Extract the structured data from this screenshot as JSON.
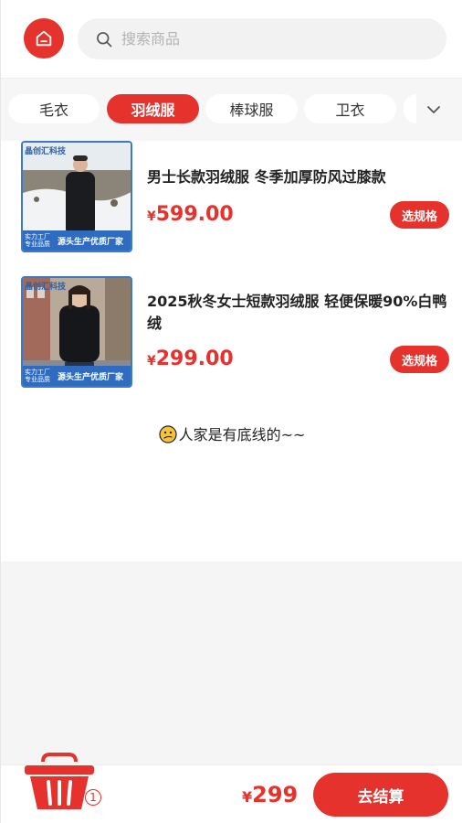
{
  "header": {
    "search": {
      "placeholder": "搜索商品",
      "value": ""
    }
  },
  "categories": {
    "tabs": [
      {
        "label": "毛衣",
        "active": false
      },
      {
        "label": "羽绒服",
        "active": true
      },
      {
        "label": "棒球服",
        "active": false
      },
      {
        "label": "卫衣",
        "active": false
      }
    ]
  },
  "products": [
    {
      "title": "男士长款羽绒服 冬季加厚防风过膝款",
      "currency": "¥",
      "price": "599.00",
      "spec_button": "选规格",
      "thumb": {
        "brand": "晶创汇科技",
        "factory": "实力工厂 专业品质",
        "tag": "源头生产优质厂家"
      }
    },
    {
      "title": "2025秋冬女士短款羽绒服 轻便保暖90%白鸭绒",
      "currency": "¥",
      "price": "299.00",
      "spec_button": "选规格",
      "thumb": {
        "brand": "晶创汇科技",
        "factory": "实力工厂 专业品质",
        "tag": "源头生产优质厂家"
      }
    }
  ],
  "list_end_text": "人家是有底线的~~",
  "bottom_bar": {
    "cart_count": "1",
    "currency": "¥",
    "total": "299",
    "checkout_label": "去结算"
  },
  "colors": {
    "accent": "#e5322d",
    "tab_bg": "#f6f6f6"
  }
}
